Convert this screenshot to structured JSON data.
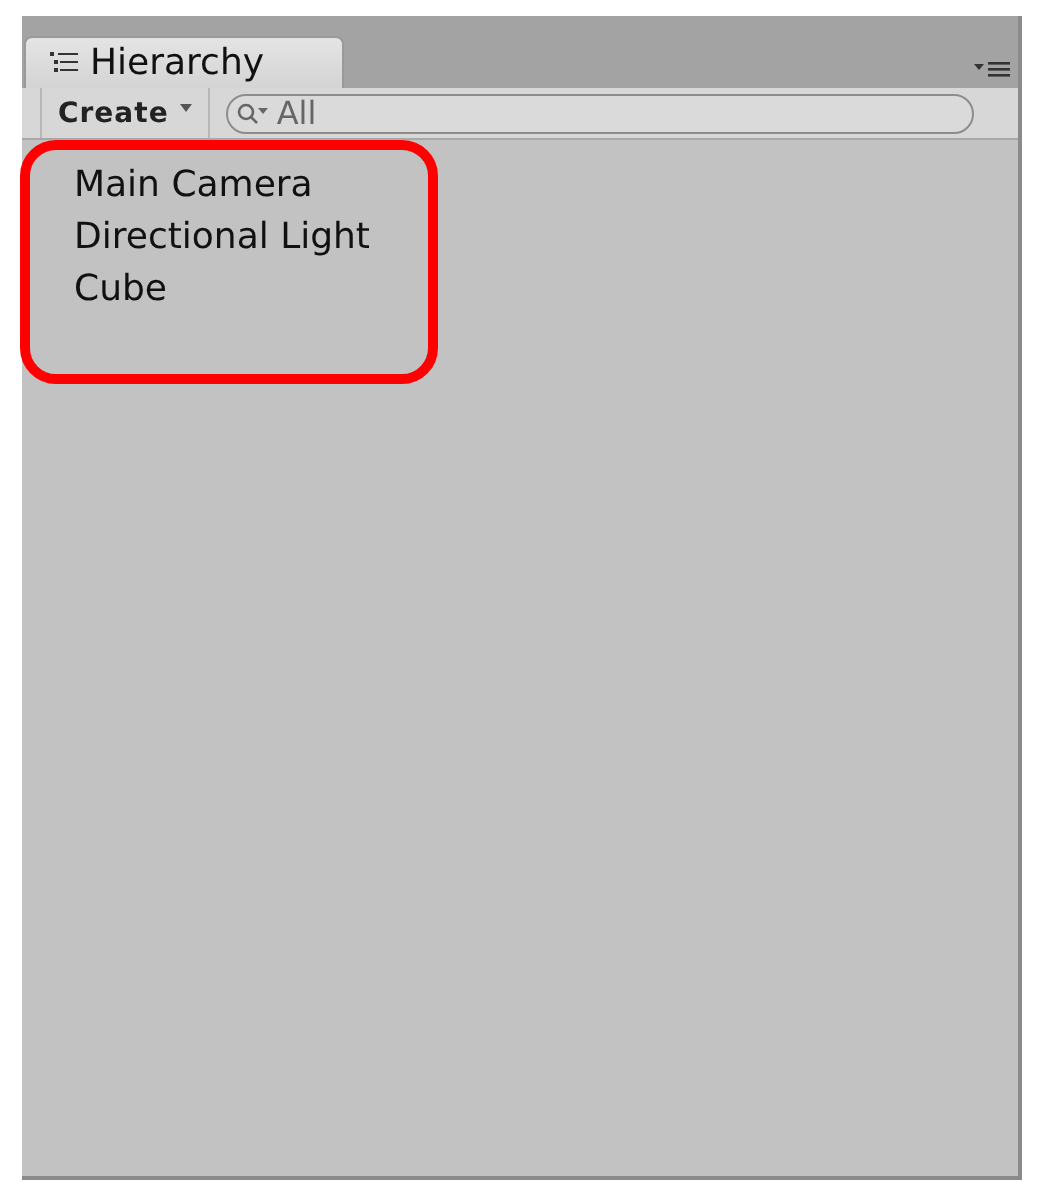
{
  "tab": {
    "title": "Hierarchy"
  },
  "toolbar": {
    "create_label": "Create",
    "search_placeholder": "All"
  },
  "items": [
    {
      "name": "Main Camera"
    },
    {
      "name": "Directional Light"
    },
    {
      "name": "Cube"
    }
  ],
  "highlight": true
}
